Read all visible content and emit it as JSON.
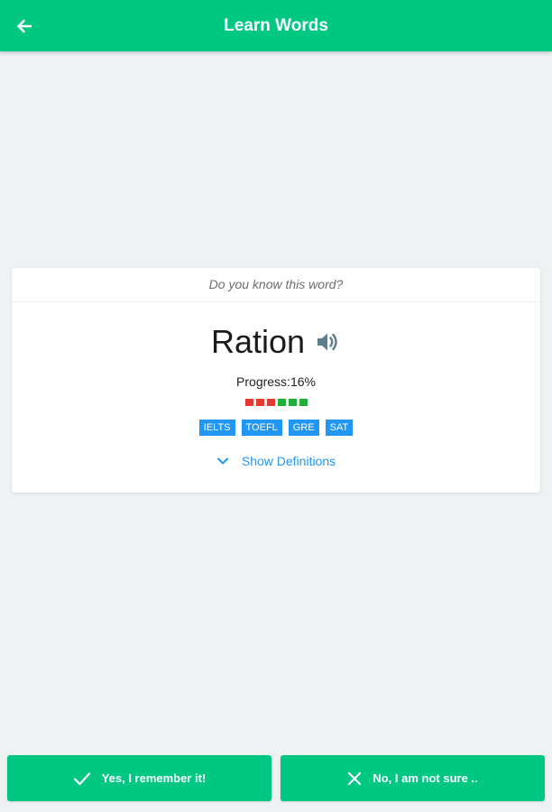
{
  "appbar": {
    "title": "Learn Words",
    "back_icon": "arrow-left-icon",
    "color": "#00c883"
  },
  "card": {
    "question": "Do you know this word?",
    "word": "Ration",
    "speaker_icon": "volume-icon",
    "progress_label": "Progress:16%",
    "progress_squares": [
      "#e53935",
      "#e53935",
      "#e53935",
      "#1fae3a",
      "#1fae3a",
      "#1fae3a"
    ],
    "tags": [
      "IELTS",
      "TOEFL",
      "GRE",
      "SAT"
    ],
    "show_definitions": "Show Definitions",
    "chevron_icon": "chevron-down-icon"
  },
  "actions": {
    "yes_label": "Yes, I remember it!",
    "yes_icon": "check-icon",
    "no_label": "No, I am not sure ..",
    "no_icon": "close-icon"
  },
  "colors": {
    "accent": "#00c883",
    "tag": "#2196f3",
    "background": "#eef2f3"
  }
}
